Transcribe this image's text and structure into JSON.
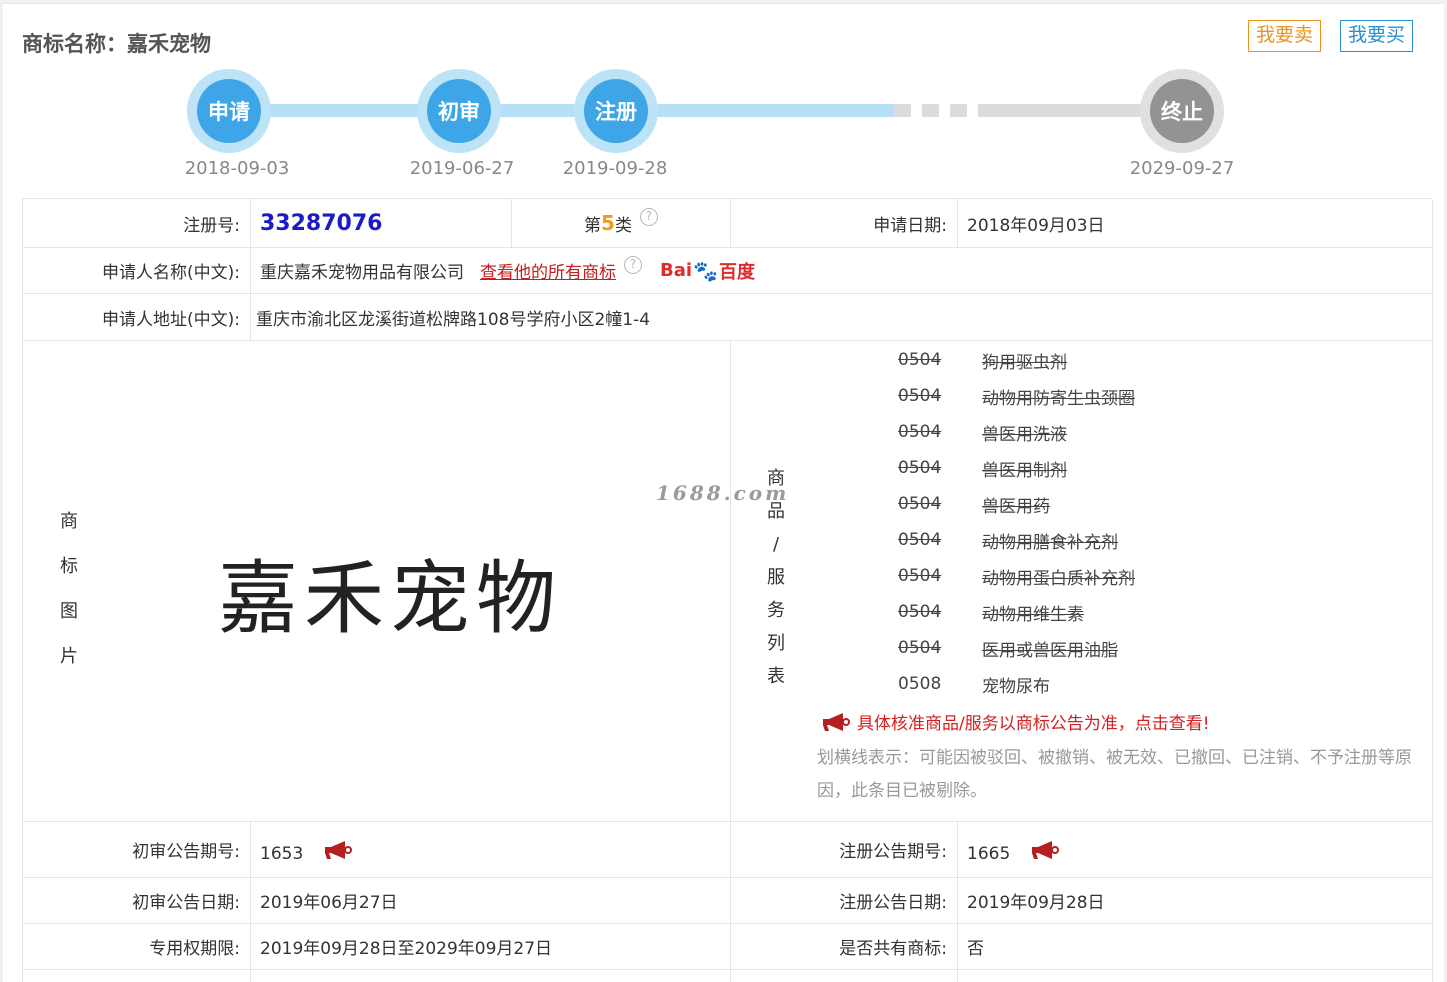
{
  "header": {
    "title": "商标名称：嘉禾宠物",
    "sell_label": "我要卖",
    "buy_label": "我要买"
  },
  "timeline": [
    {
      "label": "申请",
      "date": "2018-09-03",
      "state": "done"
    },
    {
      "label": "初审",
      "date": "2019-06-27",
      "state": "done"
    },
    {
      "label": "注册",
      "date": "2019-09-28",
      "state": "done"
    },
    {
      "label": "终止",
      "date": "2029-09-27",
      "state": "future"
    }
  ],
  "colors": {
    "accent_blue": "#3ea6e6",
    "future_grey": "#939393",
    "sell": "#e8941f",
    "buy": "#2a8fd0",
    "alert_red": "#d62020"
  },
  "info": {
    "reg_no_label": "注册号:",
    "reg_no": "33287076",
    "class_prefix": "第",
    "class_num": "5",
    "class_suffix": "类",
    "apply_date_label": "申请日期:",
    "apply_date": "2018年09月03日",
    "applicant_label": "申请人名称(中文):",
    "applicant": "重庆嘉禾宠物用品有限公司",
    "view_all": "查看他的所有商标",
    "baidu_left": "Bai",
    "baidu_right": "百度",
    "address_label": "申请人地址(中文):",
    "address": "重庆市渝北区龙溪街道松牌路108号学府小区2幢1-4",
    "image_label": [
      "商",
      "标",
      "图",
      "片"
    ],
    "logo_text": "嘉禾宠物",
    "watermark": "1688.com",
    "goods_label": [
      "商",
      "品",
      "/",
      "服",
      "务",
      "列",
      "表"
    ],
    "goods": [
      {
        "code": "0504",
        "name": "狗用驱虫剂",
        "struck": true
      },
      {
        "code": "0504",
        "name": "动物用防寄生虫颈圈",
        "struck": true
      },
      {
        "code": "0504",
        "name": "兽医用洗液",
        "struck": true
      },
      {
        "code": "0504",
        "name": "兽医用制剂",
        "struck": true
      },
      {
        "code": "0504",
        "name": "兽医用药",
        "struck": true
      },
      {
        "code": "0504",
        "name": "动物用膳食补充剂",
        "struck": true
      },
      {
        "code": "0504",
        "name": "动物用蛋白质补充剂",
        "struck": true
      },
      {
        "code": "0504",
        "name": "动物用维生素",
        "struck": true
      },
      {
        "code": "0504",
        "name": "医用或兽医用油脂",
        "struck": true
      },
      {
        "code": "0508",
        "name": "宠物尿布",
        "struck": false
      }
    ],
    "goods_notice": "具体核准商品/服务以商标公告为准，点击查看!",
    "strike_note": "划横线表示：可能因被驳回、被撤销、被无效、已撤回、已注销、不予注册等原因，此条目已被剔除。",
    "prelim_no_label": "初审公告期号:",
    "prelim_no": "1653",
    "reg_ann_no_label": "注册公告期号:",
    "reg_ann_no": "1665",
    "prelim_date_label": "初审公告日期:",
    "prelim_date": "2019年06月27日",
    "reg_ann_date_label": "注册公告日期:",
    "reg_ann_date": "2019年09月28日",
    "excl_label": "专用权期限:",
    "excl_period": "2019年09月28日至2029年09月27日",
    "shared_label": "是否共有商标:",
    "shared": "否"
  }
}
